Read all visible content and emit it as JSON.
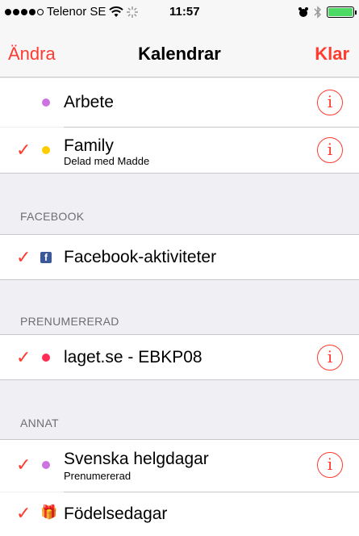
{
  "status_bar": {
    "carrier": "Telenor SE",
    "time": "11:57",
    "icons": [
      "signal-dots-icon",
      "wifi-icon",
      "activity-icon",
      "alarm-icon",
      "bluetooth-icon",
      "battery-icon"
    ]
  },
  "nav": {
    "left_button": "Ändra",
    "title": "Kalendrar",
    "right_button": "Klar"
  },
  "rows": {
    "arbete": {
      "title": "Arbete",
      "color": "#cc73e1",
      "checked": false
    },
    "family": {
      "title": "Family",
      "subtitle": "Delad med Madde",
      "color": "#ffcc00",
      "checked": true
    },
    "facebook": {
      "title": "Facebook-aktiviteter",
      "checked": true
    },
    "laget": {
      "title": "laget.se - EBKP08",
      "color": "#ff2d55",
      "checked": true
    },
    "svenska": {
      "title": "Svenska helgdagar",
      "subtitle": "Prenumererad",
      "color": "#cc73e1",
      "checked": true
    },
    "fodelse": {
      "title": "Födelsedagar",
      "checked": true
    }
  },
  "sections": {
    "facebook": "FACEBOOK",
    "prenumererad": "PRENUMERERAD",
    "annat": "ANNAT"
  },
  "glyphs": {
    "check": "✓",
    "info": "i",
    "fb": "f",
    "gift": "🎁"
  },
  "colors": {
    "accent": "#ff3b30",
    "facebook": "#3b5998",
    "battery": "#4cd964"
  }
}
